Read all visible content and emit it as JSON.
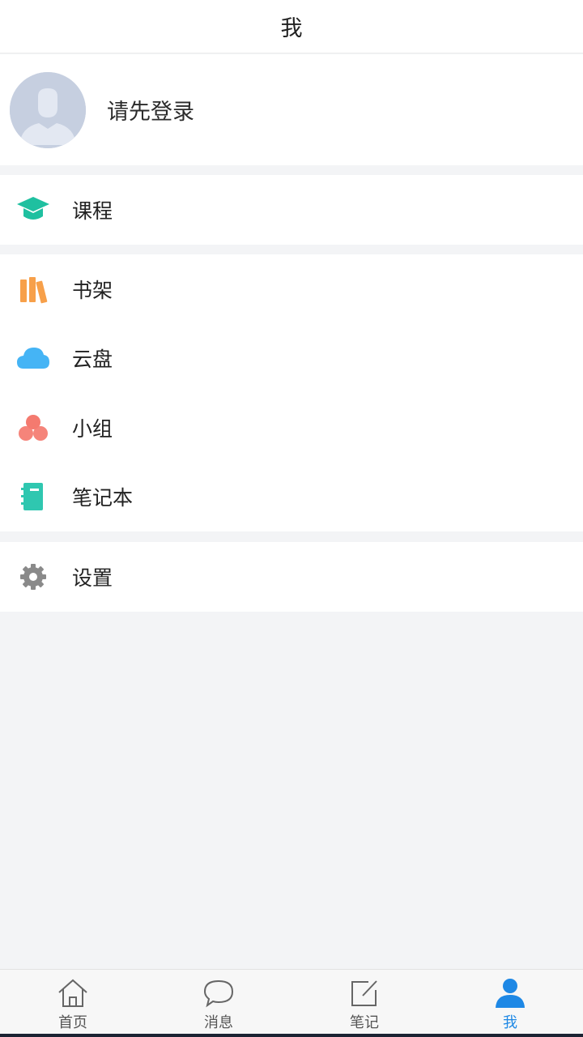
{
  "header": {
    "title": "我"
  },
  "profile": {
    "login_prompt": "请先登录"
  },
  "menu": {
    "group1": [
      {
        "label": "课程",
        "icon": "graduation-cap-icon",
        "color": "#1fc0a0"
      }
    ],
    "group2": [
      {
        "label": "书架",
        "icon": "bookshelf-icon",
        "color": "#f7a04a"
      },
      {
        "label": "云盘",
        "icon": "cloud-icon",
        "color": "#45b4f5"
      },
      {
        "label": "小组",
        "icon": "group-icon",
        "color": "#f47a6f"
      },
      {
        "label": "笔记本",
        "icon": "notebook-icon",
        "color": "#2fc7b0"
      }
    ],
    "group3": [
      {
        "label": "设置",
        "icon": "gear-icon",
        "color": "#8a8a8a"
      }
    ]
  },
  "tabbar": {
    "tabs": [
      {
        "label": "首页",
        "icon": "home-icon"
      },
      {
        "label": "消息",
        "icon": "chat-bubble-icon"
      },
      {
        "label": "笔记",
        "icon": "edit-note-icon"
      },
      {
        "label": "我",
        "icon": "user-icon",
        "active": true
      }
    ],
    "active_color": "#1e88e5"
  }
}
